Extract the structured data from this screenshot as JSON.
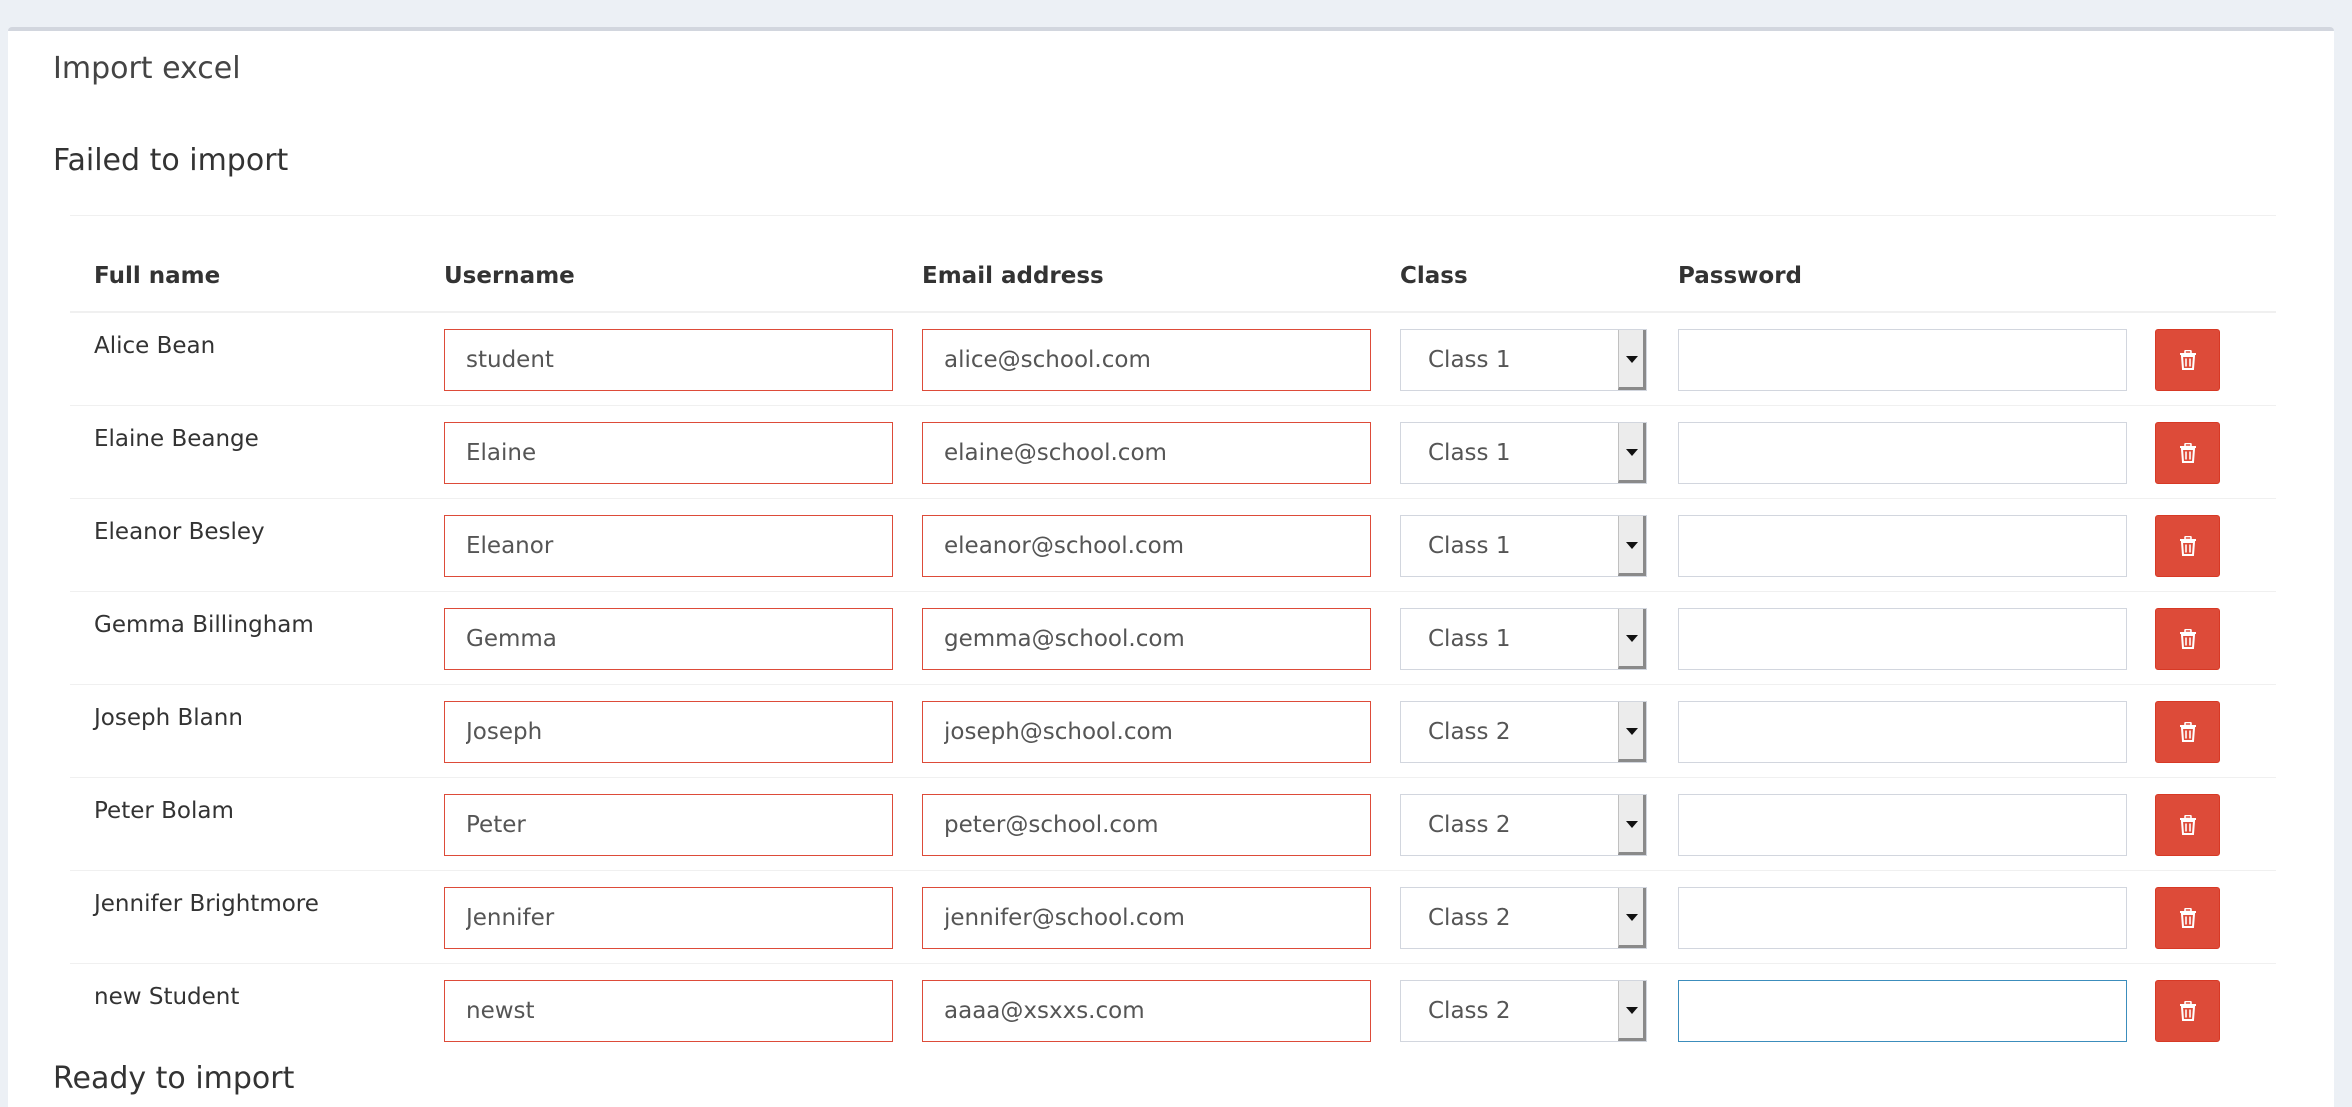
{
  "page": {
    "title": "Import excel",
    "failed_section_title": "Failed to import",
    "ready_section_title": "Ready to import"
  },
  "table": {
    "headers": {
      "full_name": "Full name",
      "username": "Username",
      "email": "Email address",
      "class": "Class",
      "password": "Password"
    },
    "rows": [
      {
        "full_name": "Alice Bean",
        "username": "student",
        "email": "alice@school.com",
        "class": "Class 1",
        "password": ""
      },
      {
        "full_name": "Elaine Beange",
        "username": "Elaine",
        "email": "elaine@school.com",
        "class": "Class 1",
        "password": ""
      },
      {
        "full_name": "Eleanor Besley",
        "username": "Eleanor",
        "email": "eleanor@school.com",
        "class": "Class 1",
        "password": ""
      },
      {
        "full_name": "Gemma Billingham",
        "username": "Gemma",
        "email": "gemma@school.com",
        "class": "Class 1",
        "password": ""
      },
      {
        "full_name": "Joseph Blann",
        "username": "Joseph",
        "email": "joseph@school.com",
        "class": "Class 2",
        "password": ""
      },
      {
        "full_name": "Peter Bolam",
        "username": "Peter",
        "email": "peter@school.com",
        "class": "Class 2",
        "password": ""
      },
      {
        "full_name": "Jennifer Brightmore",
        "username": "Jennifer",
        "email": "jennifer@school.com",
        "class": "Class 2",
        "password": ""
      },
      {
        "full_name": "new Student",
        "username": "newst",
        "email": "aaaa@xsxxs.com",
        "class": "Class 2",
        "password": ""
      }
    ]
  },
  "icons": {
    "delete": "trash-icon",
    "dropdown": "caret-down-icon"
  },
  "colors": {
    "danger": "#dd4b39",
    "focus": "#3c8dbc",
    "background": "#ecf0f5"
  }
}
